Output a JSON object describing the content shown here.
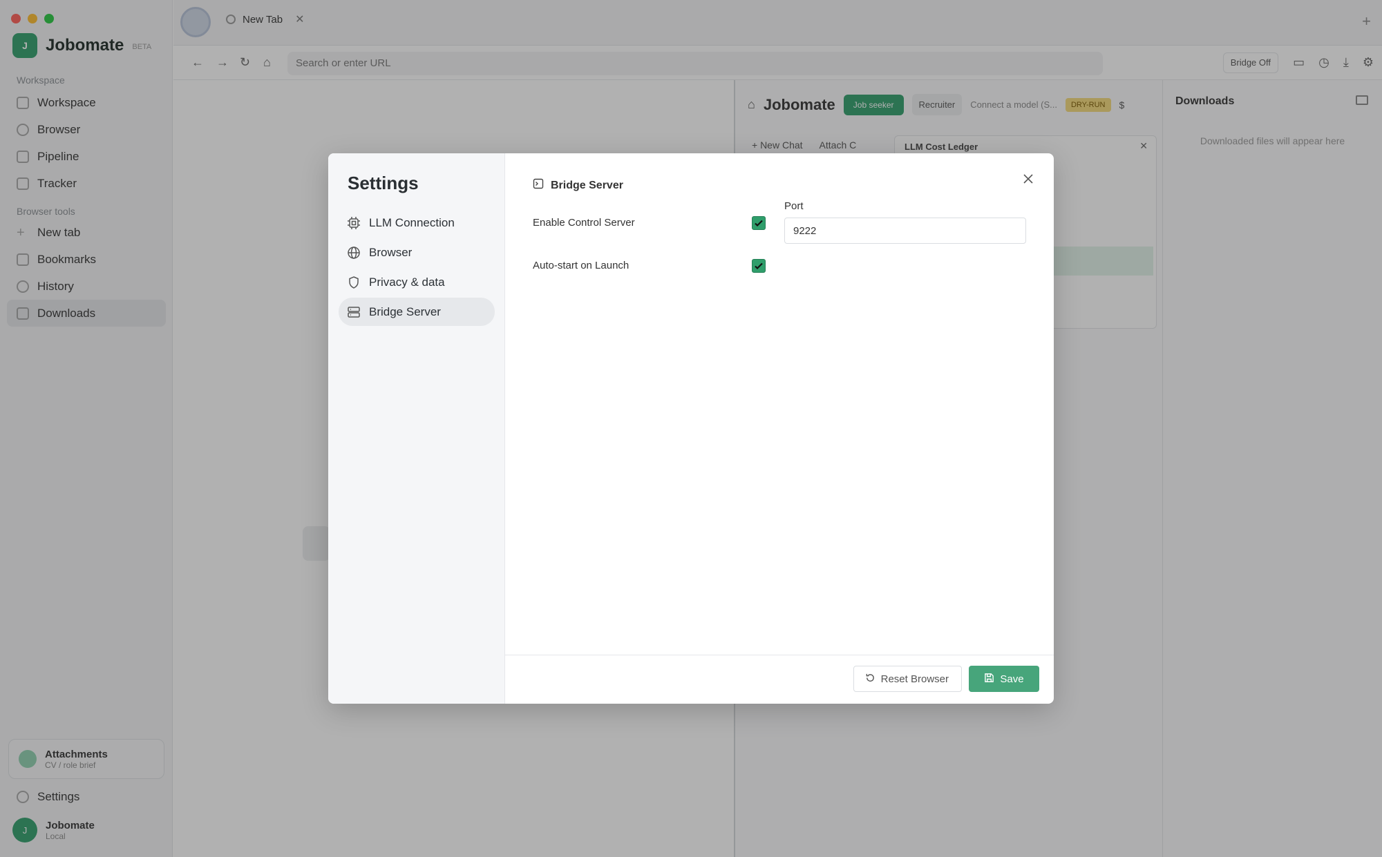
{
  "window": {
    "tab_title": "New Tab",
    "url_placeholder": "Search or enter URL"
  },
  "sidebar": {
    "brand": "Jobomate",
    "beta": "BETA",
    "logo_letter": "J",
    "section_workspace": "Workspace",
    "workspace_items": [
      {
        "label": "Workspace",
        "icon": "home-icon"
      },
      {
        "label": "Browser",
        "icon": "globe-icon"
      },
      {
        "label": "Pipeline",
        "icon": "pipeline-icon"
      },
      {
        "label": "Tracker",
        "icon": "chart-icon"
      }
    ],
    "section_tools": "Browser tools",
    "tool_items": [
      {
        "label": "New tab",
        "icon": "plus-icon"
      },
      {
        "label": "Bookmarks",
        "icon": "book-icon"
      },
      {
        "label": "History",
        "icon": "history-icon"
      },
      {
        "label": "Downloads",
        "icon": "download-icon"
      }
    ],
    "attachments_title": "Attachments",
    "attachments_sub": "CV / role brief",
    "settings_label": "Settings",
    "user_name": "Jobomate",
    "user_sub": "Local"
  },
  "toolbar": {
    "bridge_label": "Bridge Off"
  },
  "assistant": {
    "title": "Jobomate",
    "job_button": "Job seeker",
    "recruiter_button": "Recruiter",
    "status": "Connect a model (S...",
    "dry_badge": "DRY-RUN",
    "dollar": "$",
    "new_chat": "+ New Chat",
    "attach": "Attach C",
    "ledger_title": "LLM Cost Ledger"
  },
  "downloads": {
    "title": "Downloads",
    "empty": "Downloaded files will appear here"
  },
  "settings": {
    "title": "Settings",
    "nav": [
      {
        "label": "LLM Connection",
        "icon": "chip-icon"
      },
      {
        "label": "Browser",
        "icon": "globe-icon"
      },
      {
        "label": "Privacy & data",
        "icon": "shield-icon"
      },
      {
        "label": "Bridge Server",
        "icon": "server-icon"
      }
    ],
    "active_section": "Bridge Server",
    "section_title": "Bridge Server",
    "enable_label": "Enable Control Server",
    "enable_checked": true,
    "autostart_label": "Auto-start on Launch",
    "autostart_checked": true,
    "port_label": "Port",
    "port_value": "9222",
    "reset_label": "Reset Browser",
    "save_label": "Save"
  },
  "colors": {
    "accent": "#2f9e6b",
    "save_button": "#47a57b",
    "overlay": "rgba(40,40,40,0.36)"
  }
}
